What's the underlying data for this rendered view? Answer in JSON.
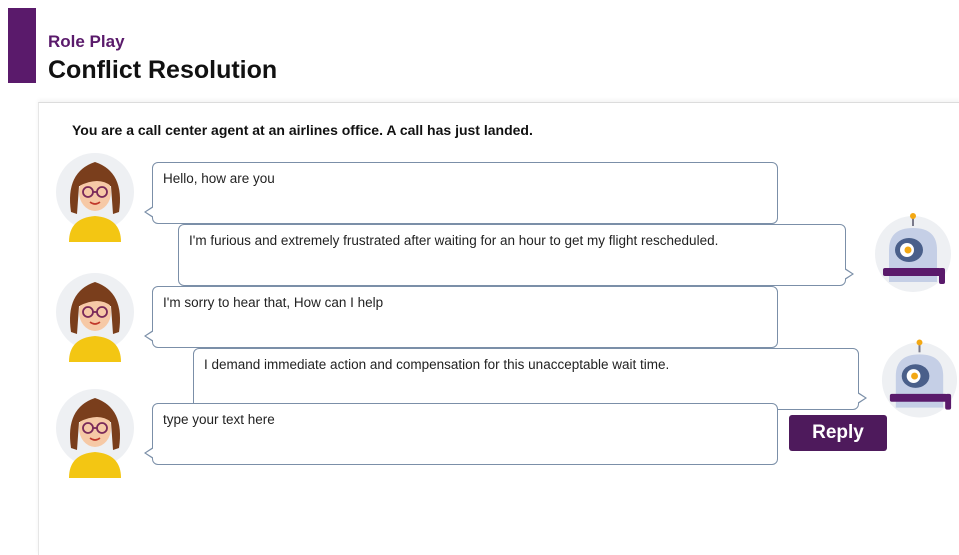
{
  "header": {
    "subtitle": "Role Play",
    "title": "Conflict Resolution"
  },
  "instruction": "You are a call center agent at an airlines office.  A call has just landed.",
  "messages": [
    {
      "speaker": "agent",
      "text": "Hello, how are you"
    },
    {
      "speaker": "customer",
      "text": "I'm furious and extremely frustrated after waiting for an hour to get my flight rescheduled."
    },
    {
      "speaker": "agent",
      "text": "I'm sorry to hear that, How can I help"
    },
    {
      "speaker": "customer",
      "text": "I demand immediate action and compensation for this unacceptable wait time."
    }
  ],
  "reply": {
    "placeholder": "type your text here",
    "value": "",
    "button_label": "Reply"
  },
  "colors": {
    "accent": "#5a1a6b",
    "button": "#4e1a5c",
    "bubble_border": "#7b8fa8",
    "avatar_shirt": "#f3c613",
    "robot_body": "#c5cfe6",
    "robot_accent": "#5a1a6b"
  },
  "icons": {
    "agent": "woman-avatar-icon",
    "customer": "robot-avatar-icon"
  }
}
